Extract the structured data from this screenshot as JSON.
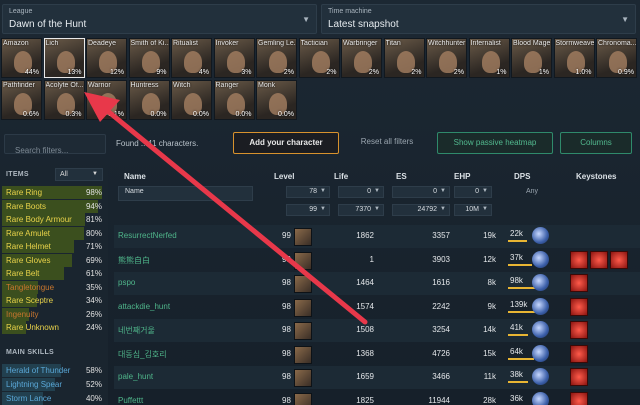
{
  "league": {
    "label": "League",
    "value": "Dawn of the Hunt"
  },
  "time_machine": {
    "label": "Time machine",
    "value": "Latest snapshot"
  },
  "classes": [
    {
      "name": "Amazon",
      "pct": "44%"
    },
    {
      "name": "Lich",
      "pct": "13%"
    },
    {
      "name": "Deadeye",
      "pct": "12%"
    },
    {
      "name": "Smith of Ki...",
      "pct": "9%"
    },
    {
      "name": "Ritualist",
      "pct": "4%"
    },
    {
      "name": "Invoker",
      "pct": "3%"
    },
    {
      "name": "Gemling Le...",
      "pct": "2%"
    },
    {
      "name": "Tactician",
      "pct": "2%"
    },
    {
      "name": "Warbringer",
      "pct": "2%"
    },
    {
      "name": "Titan",
      "pct": "2%"
    },
    {
      "name": "Witchhunter",
      "pct": "2%"
    },
    {
      "name": "Infernalist",
      "pct": "1%"
    },
    {
      "name": "Blood Mage",
      "pct": "1%"
    },
    {
      "name": "Stormweaver",
      "pct": "1.0%"
    },
    {
      "name": "Chronoma...",
      "pct": "0.9%"
    },
    {
      "name": "Pathfinder",
      "pct": "0.6%"
    },
    {
      "name": "Acolyte Of...",
      "pct": "0.3%"
    },
    {
      "name": "Warrior",
      "pct": "0.1%"
    },
    {
      "name": "Huntress",
      "pct": "0.0%"
    },
    {
      "name": "Witch",
      "pct": "0.0%"
    },
    {
      "name": "Ranger",
      "pct": "0.0%"
    },
    {
      "name": "Monk",
      "pct": "0.0%"
    }
  ],
  "toolbar": {
    "search_placeholder": "Search filters...",
    "found_prefix": "Found",
    "found_count": "...41",
    "found_suffix": "characters.",
    "add": "Add your character",
    "reset": "Reset all filters",
    "heatmap": "Show passive heatmap",
    "columns": "Columns"
  },
  "items": {
    "header": "ITEMS",
    "select": "All",
    "rows": [
      {
        "name": "Rare Ring",
        "pct": "98%",
        "frac": 0.98,
        "color": "#e9d34a"
      },
      {
        "name": "Rare Boots",
        "pct": "94%",
        "frac": 0.94,
        "color": "#e9d34a"
      },
      {
        "name": "Rare Body Armour",
        "pct": "81%",
        "frac": 0.81,
        "color": "#e9d34a"
      },
      {
        "name": "Rare Amulet",
        "pct": "80%",
        "frac": 0.8,
        "color": "#e9d34a"
      },
      {
        "name": "Rare Helmet",
        "pct": "71%",
        "frac": 0.71,
        "color": "#e9d34a"
      },
      {
        "name": "Rare Gloves",
        "pct": "69%",
        "frac": 0.69,
        "color": "#e9d34a"
      },
      {
        "name": "Rare Belt",
        "pct": "61%",
        "frac": 0.61,
        "color": "#e9d34a"
      },
      {
        "name": "Tangletongue",
        "pct": "35%",
        "frac": 0.35,
        "color": "#c9762e"
      },
      {
        "name": "Rare Sceptre",
        "pct": "34%",
        "frac": 0.34,
        "color": "#e9d34a"
      },
      {
        "name": "Ingenuity",
        "pct": "26%",
        "frac": 0.26,
        "color": "#c9762e"
      },
      {
        "name": "Rare Unknown",
        "pct": "24%",
        "frac": 0.24,
        "color": "#e9d34a"
      }
    ]
  },
  "skills": {
    "header": "MAIN SKILLS",
    "rows": [
      {
        "name": "Herald of Thunder",
        "pct": "58%",
        "frac": 0.58
      },
      {
        "name": "Lightning Spear",
        "pct": "52%",
        "frac": 0.52
      },
      {
        "name": "Storm Lance",
        "pct": "40%",
        "frac": 0.4
      }
    ]
  },
  "table": {
    "headers": {
      "name": "Name",
      "level": "Level",
      "life": "Life",
      "es": "ES",
      "ehp": "EHP",
      "dps": "DPS",
      "keystones": "Keystones"
    },
    "filters": {
      "name_placeholder": "Name",
      "level_min": "78",
      "level_max": "99",
      "life_min": "0",
      "life_max": "7370",
      "es_min": "0",
      "es_max": "24792",
      "ehp_min": "0",
      "ehp_max": "10M",
      "dps": "Any"
    },
    "rows": [
      {
        "name": "ResurrectNerfed",
        "level": "99",
        "life": "1862",
        "es": "3357",
        "ehp": "19k",
        "dps": "22k",
        "dps_frac": 0.55,
        "keystones": 0
      },
      {
        "name": "熊熊自白",
        "level": "99",
        "life": "1",
        "es": "3903",
        "ehp": "12k",
        "dps": "37k",
        "dps_frac": 0.7,
        "keystones": 3
      },
      {
        "name": "pspo",
        "level": "98",
        "life": "1464",
        "es": "1616",
        "ehp": "8k",
        "dps": "98k",
        "dps_frac": 0.85,
        "keystones": 1
      },
      {
        "name": "attackdie_hunt",
        "level": "98",
        "life": "1574",
        "es": "2242",
        "ehp": "9k",
        "dps": "139k",
        "dps_frac": 0.95,
        "keystones": 1
      },
      {
        "name": "네번째거울",
        "level": "98",
        "life": "1508",
        "es": "3254",
        "ehp": "14k",
        "dps": "41k",
        "dps_frac": 0.6,
        "keystones": 1
      },
      {
        "name": "대동심_김호리",
        "level": "98",
        "life": "1368",
        "es": "4726",
        "ehp": "15k",
        "dps": "64k",
        "dps_frac": 0.75,
        "keystones": 1
      },
      {
        "name": "pale_hunt",
        "level": "98",
        "life": "1659",
        "es": "3466",
        "ehp": "11k",
        "dps": "38k",
        "dps_frac": 0.6,
        "keystones": 1
      },
      {
        "name": "Puffettt",
        "level": "98",
        "life": "1825",
        "es": "11944",
        "ehp": "28k",
        "dps": "36k",
        "dps_frac": 0.6,
        "keystones": 1
      }
    ]
  }
}
